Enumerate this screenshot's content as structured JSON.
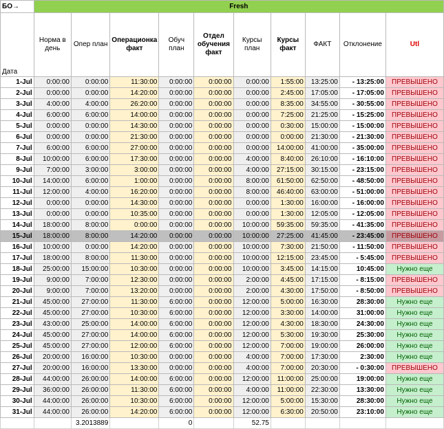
{
  "header": {
    "corner": "БО→",
    "group": "Fresh",
    "columns": [
      "Дата",
      "Норма в день",
      "Опер план",
      "Операционка факт",
      "Обуч план",
      "Отдел обучения факт",
      "Курсы план",
      "Курсы факт",
      "ФАКТ",
      "Отклонение",
      "Utl"
    ]
  },
  "rows": [
    {
      "date": "1-Jul",
      "norm": "0:00:00",
      "oper_plan": "0:00:00",
      "oper_fact": "11:30:00",
      "train_plan": "0:00:00",
      "train_fact": "0:00:00",
      "course_plan": "0:00:00",
      "course_fact": "1:55:00",
      "fact": "13:25:00",
      "dev": "- 13:25:00",
      "utl": "ПРЕВЫШЕНО",
      "status": "over"
    },
    {
      "date": "2-Jul",
      "norm": "0:00:00",
      "oper_plan": "0:00:00",
      "oper_fact": "14:20:00",
      "train_plan": "0:00:00",
      "train_fact": "0:00:00",
      "course_plan": "0:00:00",
      "course_fact": "2:45:00",
      "fact": "17:05:00",
      "dev": "- 17:05:00",
      "utl": "ПРЕВЫШЕНО",
      "status": "over"
    },
    {
      "date": "3-Jul",
      "norm": "4:00:00",
      "oper_plan": "4:00:00",
      "oper_fact": "26:20:00",
      "train_plan": "0:00:00",
      "train_fact": "0:00:00",
      "course_plan": "0:00:00",
      "course_fact": "8:35:00",
      "fact": "34:55:00",
      "dev": "- 30:55:00",
      "utl": "ПРЕВЫШЕНО",
      "status": "over"
    },
    {
      "date": "4-Jul",
      "norm": "6:00:00",
      "oper_plan": "6:00:00",
      "oper_fact": "14:00:00",
      "train_plan": "0:00:00",
      "train_fact": "0:00:00",
      "course_plan": "0:00:00",
      "course_fact": "7:25:00",
      "fact": "21:25:00",
      "dev": "- 15:25:00",
      "utl": "ПРЕВЫШЕНО",
      "status": "over"
    },
    {
      "date": "5-Jul",
      "norm": "0:00:00",
      "oper_plan": "0:00:00",
      "oper_fact": "14:30:00",
      "train_plan": "0:00:00",
      "train_fact": "0:00:00",
      "course_plan": "0:00:00",
      "course_fact": "0:30:00",
      "fact": "15:00:00",
      "dev": "- 15:00:00",
      "utl": "ПРЕВЫШЕНО",
      "status": "over"
    },
    {
      "date": "6-Jul",
      "norm": "0:00:00",
      "oper_plan": "0:00:00",
      "oper_fact": "21:30:00",
      "train_plan": "0:00:00",
      "train_fact": "0:00:00",
      "course_plan": "0:00:00",
      "course_fact": "0:00:00",
      "fact": "21:30:00",
      "dev": "- 21:30:00",
      "utl": "ПРЕВЫШЕНО",
      "status": "over"
    },
    {
      "date": "7-Jul",
      "norm": "6:00:00",
      "oper_plan": "6:00:00",
      "oper_fact": "27:00:00",
      "train_plan": "0:00:00",
      "train_fact": "0:00:00",
      "course_plan": "0:00:00",
      "course_fact": "14:00:00",
      "fact": "41:00:00",
      "dev": "- 35:00:00",
      "utl": "ПРЕВЫШЕНО",
      "status": "over"
    },
    {
      "date": "8-Jul",
      "norm": "10:00:00",
      "oper_plan": "6:00:00",
      "oper_fact": "17:30:00",
      "train_plan": "0:00:00",
      "train_fact": "0:00:00",
      "course_plan": "4:00:00",
      "course_fact": "8:40:00",
      "fact": "26:10:00",
      "dev": "- 16:10:00",
      "utl": "ПРЕВЫШЕНО",
      "status": "over"
    },
    {
      "date": "9-Jul",
      "norm": "7:00:00",
      "oper_plan": "3:00:00",
      "oper_fact": "3:00:00",
      "train_plan": "0:00:00",
      "train_fact": "0:00:00",
      "course_plan": "4:00:00",
      "course_fact": "27:15:00",
      "fact": "30:15:00",
      "dev": "- 23:15:00",
      "utl": "ПРЕВЫШЕНО",
      "status": "over"
    },
    {
      "date": "10-Jul",
      "norm": "14:00:00",
      "oper_plan": "6:00:00",
      "oper_fact": "1:00:00",
      "train_plan": "0:00:00",
      "train_fact": "0:00:00",
      "course_plan": "8:00:00",
      "course_fact": "61:50:00",
      "fact": "62:50:00",
      "dev": "- 48:50:00",
      "utl": "ПРЕВЫШЕНО",
      "status": "over"
    },
    {
      "date": "11-Jul",
      "norm": "12:00:00",
      "oper_plan": "4:00:00",
      "oper_fact": "16:20:00",
      "train_plan": "0:00:00",
      "train_fact": "0:00:00",
      "course_plan": "8:00:00",
      "course_fact": "46:40:00",
      "fact": "63:00:00",
      "dev": "- 51:00:00",
      "utl": "ПРЕВЫШЕНО",
      "status": "over"
    },
    {
      "date": "12-Jul",
      "norm": "0:00:00",
      "oper_plan": "0:00:00",
      "oper_fact": "14:30:00",
      "train_plan": "0:00:00",
      "train_fact": "0:00:00",
      "course_plan": "0:00:00",
      "course_fact": "1:30:00",
      "fact": "16:00:00",
      "dev": "- 16:00:00",
      "utl": "ПРЕВЫШЕНО",
      "status": "over"
    },
    {
      "date": "13-Jul",
      "norm": "0:00:00",
      "oper_plan": "0:00:00",
      "oper_fact": "10:35:00",
      "train_plan": "0:00:00",
      "train_fact": "0:00:00",
      "course_plan": "0:00:00",
      "course_fact": "1:30:00",
      "fact": "12:05:00",
      "dev": "- 12:05:00",
      "utl": "ПРЕВЫШЕНО",
      "status": "over"
    },
    {
      "date": "14-Jul",
      "norm": "18:00:00",
      "oper_plan": "8:00:00",
      "oper_fact": "0:00:00",
      "train_plan": "0:00:00",
      "train_fact": "0:00:00",
      "course_plan": "10:00:00",
      "course_fact": "59:35:00",
      "fact": "59:35:00",
      "dev": "- 41:35:00",
      "utl": "ПРЕВЫШЕНО",
      "status": "over"
    },
    {
      "date": "15-Jul",
      "norm": "18:00:00",
      "oper_plan": "8:00:00",
      "oper_fact": "14:20:00",
      "train_plan": "0:00:00",
      "train_fact": "0:00:00",
      "course_plan": "10:00:00",
      "course_fact": "27:25:00",
      "fact": "41:45:00",
      "dev": "- 23:45:00",
      "utl": "ПРЕВЫШЕНО",
      "status": "over",
      "selected": true
    },
    {
      "date": "16-Jul",
      "norm": "10:00:00",
      "oper_plan": "0:00:00",
      "oper_fact": "14:20:00",
      "train_plan": "0:00:00",
      "train_fact": "0:00:00",
      "course_plan": "10:00:00",
      "course_fact": "7:30:00",
      "fact": "21:50:00",
      "dev": "- 11:50:00",
      "utl": "ПРЕВЫШЕНО",
      "status": "over"
    },
    {
      "date": "17-Jul",
      "norm": "18:00:00",
      "oper_plan": "8:00:00",
      "oper_fact": "11:30:00",
      "train_plan": "0:00:00",
      "train_fact": "0:00:00",
      "course_plan": "10:00:00",
      "course_fact": "12:15:00",
      "fact": "23:45:00",
      "dev": "- 5:45:00",
      "utl": "ПРЕВЫШЕНО",
      "status": "over"
    },
    {
      "date": "18-Jul",
      "norm": "25:00:00",
      "oper_plan": "15:00:00",
      "oper_fact": "10:30:00",
      "train_plan": "0:00:00",
      "train_fact": "0:00:00",
      "course_plan": "10:00:00",
      "course_fact": "3:45:00",
      "fact": "14:15:00",
      "dev": "10:45:00",
      "utl": "Нужно еще",
      "status": "need"
    },
    {
      "date": "19-Jul",
      "norm": "9:00:00",
      "oper_plan": "7:00:00",
      "oper_fact": "12:30:00",
      "train_plan": "0:00:00",
      "train_fact": "0:00:00",
      "course_plan": "2:00:00",
      "course_fact": "4:45:00",
      "fact": "17:15:00",
      "dev": "- 8:15:00",
      "utl": "ПРЕВЫШЕНО",
      "status": "over"
    },
    {
      "date": "20-Jul",
      "norm": "9:00:00",
      "oper_plan": "7:00:00",
      "oper_fact": "13:20:00",
      "train_plan": "0:00:00",
      "train_fact": "0:00:00",
      "course_plan": "2:00:00",
      "course_fact": "4:30:00",
      "fact": "17:50:00",
      "dev": "- 8:50:00",
      "utl": "ПРЕВЫШЕНО",
      "status": "over"
    },
    {
      "date": "21-Jul",
      "norm": "45:00:00",
      "oper_plan": "27:00:00",
      "oper_fact": "11:30:00",
      "train_plan": "6:00:00",
      "train_fact": "0:00:00",
      "course_plan": "12:00:00",
      "course_fact": "5:00:00",
      "fact": "16:30:00",
      "dev": "28:30:00",
      "utl": "Нужно еще",
      "status": "need"
    },
    {
      "date": "22-Jul",
      "norm": "45:00:00",
      "oper_plan": "27:00:00",
      "oper_fact": "10:30:00",
      "train_plan": "6:00:00",
      "train_fact": "0:00:00",
      "course_plan": "12:00:00",
      "course_fact": "3:30:00",
      "fact": "14:00:00",
      "dev": "31:00:00",
      "utl": "Нужно еще",
      "status": "need"
    },
    {
      "date": "23-Jul",
      "norm": "43:00:00",
      "oper_plan": "25:00:00",
      "oper_fact": "14:00:00",
      "train_plan": "6:00:00",
      "train_fact": "0:00:00",
      "course_plan": "12:00:00",
      "course_fact": "4:30:00",
      "fact": "18:30:00",
      "dev": "24:30:00",
      "utl": "Нужно еще",
      "status": "need"
    },
    {
      "date": "24-Jul",
      "norm": "45:00:00",
      "oper_plan": "27:00:00",
      "oper_fact": "14:00:00",
      "train_plan": "6:00:00",
      "train_fact": "0:00:00",
      "course_plan": "12:00:00",
      "course_fact": "5:30:00",
      "fact": "19:30:00",
      "dev": "25:30:00",
      "utl": "Нужно еще",
      "status": "need"
    },
    {
      "date": "25-Jul",
      "norm": "45:00:00",
      "oper_plan": "27:00:00",
      "oper_fact": "12:00:00",
      "train_plan": "6:00:00",
      "train_fact": "0:00:00",
      "course_plan": "12:00:00",
      "course_fact": "7:00:00",
      "fact": "19:00:00",
      "dev": "26:00:00",
      "utl": "Нужно еще",
      "status": "need"
    },
    {
      "date": "26-Jul",
      "norm": "20:00:00",
      "oper_plan": "16:00:00",
      "oper_fact": "10:30:00",
      "train_plan": "0:00:00",
      "train_fact": "0:00:00",
      "course_plan": "4:00:00",
      "course_fact": "7:00:00",
      "fact": "17:30:00",
      "dev": "2:30:00",
      "utl": "Нужно еще",
      "status": "need"
    },
    {
      "date": "27-Jul",
      "norm": "20:00:00",
      "oper_plan": "16:00:00",
      "oper_fact": "13:30:00",
      "train_plan": "0:00:00",
      "train_fact": "0:00:00",
      "course_plan": "4:00:00",
      "course_fact": "7:00:00",
      "fact": "20:30:00",
      "dev": "- 0:30:00",
      "utl": "ПРЕВЫШЕНО",
      "status": "over"
    },
    {
      "date": "28-Jul",
      "norm": "44:00:00",
      "oper_plan": "26:00:00",
      "oper_fact": "14:00:00",
      "train_plan": "6:00:00",
      "train_fact": "0:00:00",
      "course_plan": "12:00:00",
      "course_fact": "11:00:00",
      "fact": "25:00:00",
      "dev": "19:00:00",
      "utl": "Нужно еще",
      "status": "need"
    },
    {
      "date": "29-Jul",
      "norm": "36:00:00",
      "oper_plan": "26:00:00",
      "oper_fact": "11:30:00",
      "train_plan": "6:00:00",
      "train_fact": "0:00:00",
      "course_plan": "4:00:00",
      "course_fact": "11:00:00",
      "fact": "22:30:00",
      "dev": "13:30:00",
      "utl": "Нужно еще",
      "status": "need"
    },
    {
      "date": "30-Jul",
      "norm": "44:00:00",
      "oper_plan": "26:00:00",
      "oper_fact": "10:30:00",
      "train_plan": "6:00:00",
      "train_fact": "0:00:00",
      "course_plan": "12:00:00",
      "course_fact": "5:00:00",
      "fact": "15:30:00",
      "dev": "28:30:00",
      "utl": "Нужно еще",
      "status": "need"
    },
    {
      "date": "31-Jul",
      "norm": "44:00:00",
      "oper_plan": "26:00:00",
      "oper_fact": "14:20:00",
      "train_plan": "6:00:00",
      "train_fact": "0:00:00",
      "course_plan": "12:00:00",
      "course_fact": "6:30:00",
      "fact": "20:50:00",
      "dev": "23:10:00",
      "utl": "Нужно еще",
      "status": "need"
    }
  ],
  "totals": {
    "oper_plan": "3.2013889",
    "train_plan": "0",
    "course_plan": "52.75"
  },
  "colors": {
    "group_header": "#92d050",
    "over_bg": "#ffc7ce",
    "over_text": "#9c0006",
    "need_bg": "#c6efce",
    "need_text": "#006100",
    "fact_col_bg": "#fff2cc",
    "plan_col_bg": "#efefef",
    "utl_header": "#e00000"
  }
}
